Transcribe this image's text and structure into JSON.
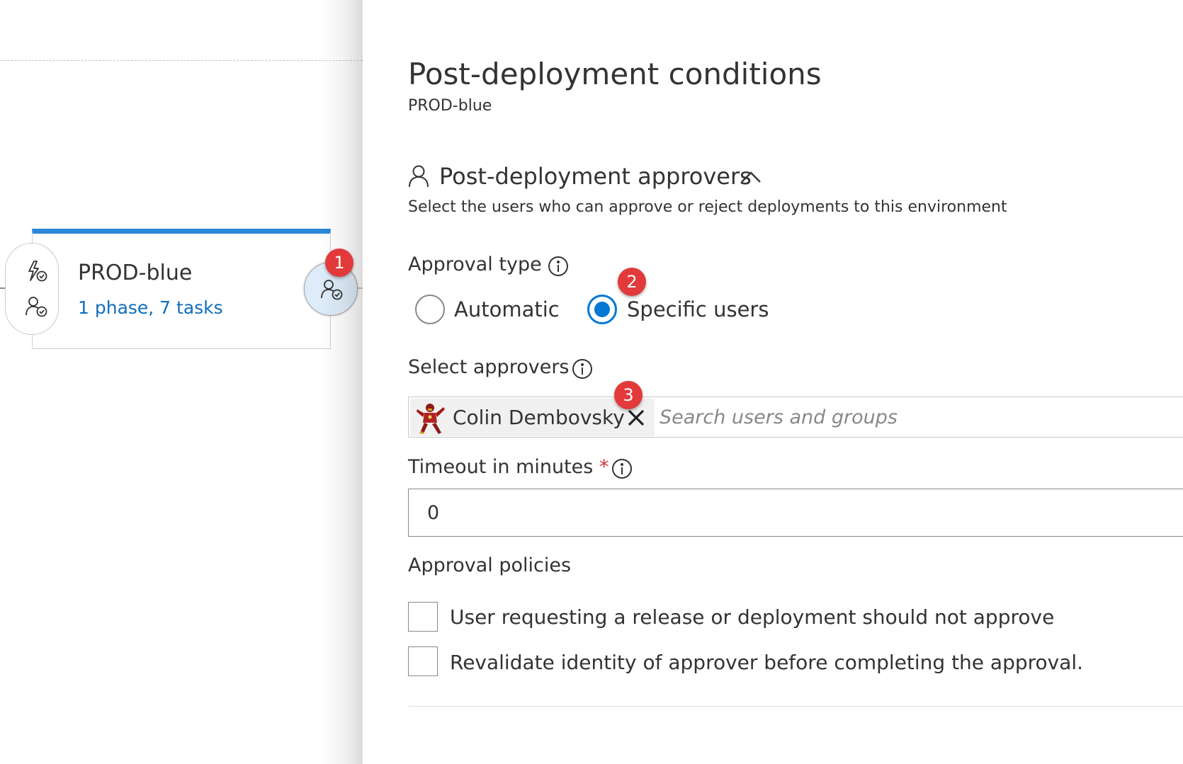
{
  "stage": {
    "name": "PROD-blue",
    "summary": "1 phase, 7 tasks"
  },
  "badges": {
    "post_approvals": "1",
    "specific_users": "2",
    "approver_chip": "3"
  },
  "panel": {
    "title": "Post-deployment conditions",
    "subtitle": "PROD-blue",
    "section": {
      "title": "Post-deployment approvers",
      "description": "Select the users who can approve or reject deployments to this environment"
    },
    "approval_type": {
      "label": "Approval type",
      "options": [
        {
          "label": "Automatic",
          "selected": false
        },
        {
          "label": "Specific users",
          "selected": true
        }
      ]
    },
    "approvers": {
      "label": "Select approvers",
      "selected": [
        {
          "name": "Colin Dembovsky"
        }
      ],
      "search_placeholder": "Search users and groups",
      "search_value": ""
    },
    "timeout": {
      "label": "Timeout in minutes",
      "required_mark": "*",
      "value": "0"
    },
    "policies": {
      "label": "Approval policies",
      "items": [
        {
          "label": "User requesting a release or deployment should not approve",
          "checked": false
        },
        {
          "label": "Revalidate identity of approver before completing the approval.",
          "checked": false
        }
      ]
    }
  },
  "icons": {
    "pre_triggers": "lightning-check-icon",
    "pre_approvals": "person-check-icon",
    "post_approvals": "person-check-icon",
    "section": "person-icon",
    "collapse": "chevron-up-icon",
    "info": "info-icon",
    "remove": "close-icon"
  },
  "colors": {
    "accent": "#0078d4",
    "stage_bar": "#2b88d8",
    "link": "#106ebe",
    "badge": "#e23a3a",
    "post_circle": "#deecf9",
    "required": "#d13438"
  }
}
